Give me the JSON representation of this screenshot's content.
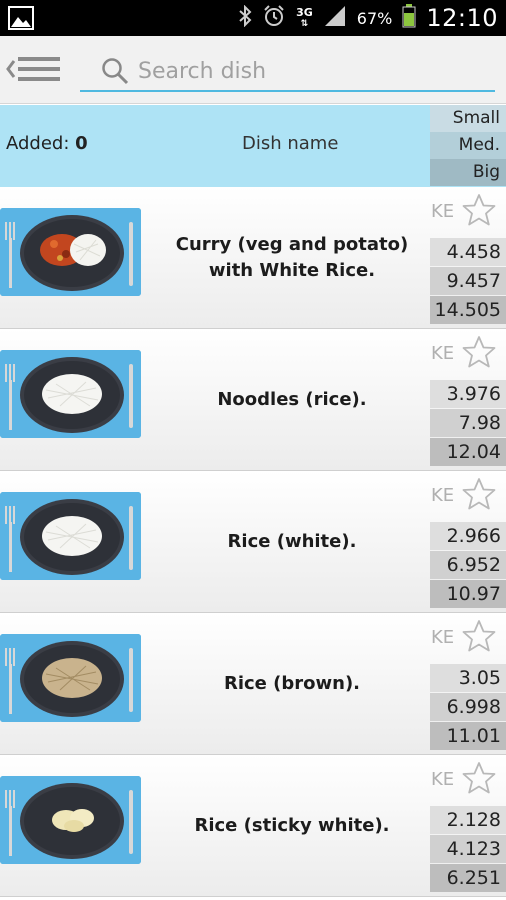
{
  "status_bar": {
    "network": "3G",
    "battery": "67%",
    "time": "12:10"
  },
  "search": {
    "placeholder": "Search dish"
  },
  "header": {
    "added_label": "Added:",
    "added_count": "0",
    "dish_name_label": "Dish name",
    "sizes": [
      "Small",
      "Med.",
      "Big"
    ]
  },
  "dishes": [
    {
      "name_line1": "Curry (veg and potato)",
      "name_line2": "with White Rice.",
      "ke": "KE",
      "small": "4.458",
      "med": "9.457",
      "big": "14.505",
      "food": "curry-rice"
    },
    {
      "name_line1": "Noodles (rice).",
      "name_line2": "",
      "ke": "KE",
      "small": "3.976",
      "med": "7.98",
      "big": "12.04",
      "food": "white"
    },
    {
      "name_line1": "Rice (white).",
      "name_line2": "",
      "ke": "KE",
      "small": "2.966",
      "med": "6.952",
      "big": "10.97",
      "food": "white"
    },
    {
      "name_line1": "Rice (brown).",
      "name_line2": "",
      "ke": "KE",
      "small": "3.05",
      "med": "6.998",
      "big": "11.01",
      "food": "brown"
    },
    {
      "name_line1": "Rice (sticky white).",
      "name_line2": "",
      "ke": "KE",
      "small": "2.128",
      "med": "4.123",
      "big": "6.251",
      "food": "sticky"
    }
  ],
  "colors": {
    "header_bg": "#aee3f5",
    "accent": "#4fb9e0",
    "thumb_bg": "#5ab4e4"
  }
}
